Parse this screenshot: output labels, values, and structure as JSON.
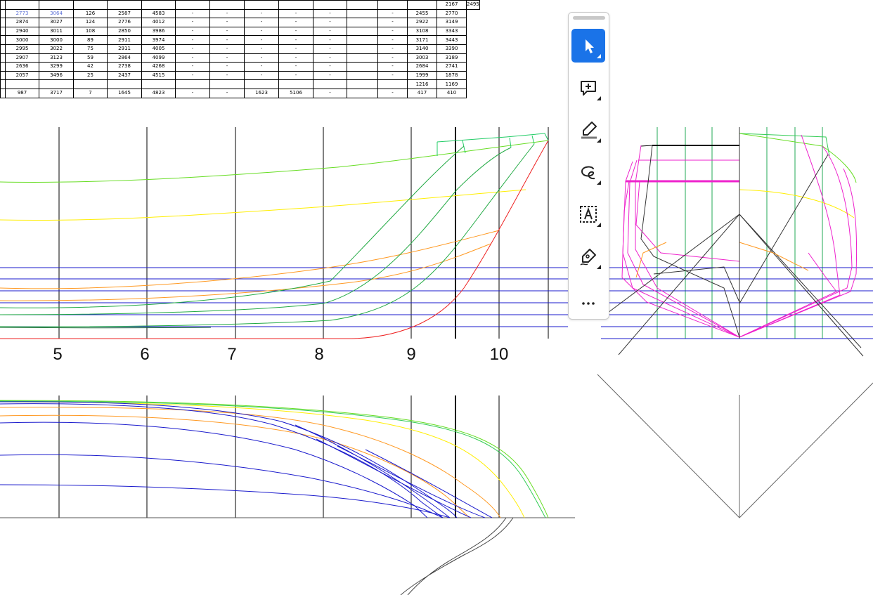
{
  "offset_table": {
    "rows": [
      [
        "",
        "",
        "",
        "",
        "",
        "",
        "",
        "",
        "",
        "",
        "",
        "",
        "",
        "2167",
        "2495"
      ],
      [
        "2773",
        "3064",
        "126",
        "2587",
        "4583",
        "-",
        "-",
        "-",
        "-",
        "-",
        "",
        "-",
        "2455",
        "2770"
      ],
      [
        "2874",
        "3027",
        "124",
        "2776",
        "4012",
        "-",
        "-",
        "-",
        "-",
        "-",
        "",
        "-",
        "2922",
        "3149"
      ],
      [
        "2940",
        "3011",
        "108",
        "2850",
        "3986",
        "-",
        "-",
        "-",
        "-",
        "-",
        "",
        "-",
        "3108",
        "3343"
      ],
      [
        "3000",
        "3000",
        "89",
        "2911",
        "3974",
        "-",
        "-",
        "-",
        "-",
        "-",
        "",
        "-",
        "3171",
        "3443"
      ],
      [
        "2995",
        "3022",
        "75",
        "2911",
        "4005",
        "-",
        "-",
        "-",
        "-",
        "-",
        "",
        "-",
        "3140",
        "3390"
      ],
      [
        "2907",
        "3123",
        "59",
        "2864",
        "4099",
        "-",
        "-",
        "-",
        "-",
        "-",
        "",
        "-",
        "3003",
        "3189"
      ],
      [
        "2636",
        "3299",
        "42",
        "2738",
        "4268",
        "-",
        "-",
        "-",
        "-",
        "-",
        "",
        "-",
        "2684",
        "2741"
      ],
      [
        "2057",
        "3496",
        "25",
        "2437",
        "4515",
        "-",
        "-",
        "-",
        "-",
        "-",
        "",
        "-",
        "1999",
        "1878"
      ],
      [
        "",
        "",
        "",
        "",
        "",
        "",
        "",
        "",
        "",
        "",
        "",
        "",
        "1216",
        "1169"
      ],
      [
        "987",
        "3717",
        "7",
        "1645",
        "4823",
        "-",
        "-",
        "1623",
        "5106",
        "-",
        "",
        "-",
        "417",
        "410"
      ]
    ]
  },
  "station_labels": [
    "5",
    "6",
    "7",
    "8",
    "9",
    "10"
  ],
  "colors": {
    "sheer": "#66dd22",
    "waterline_yellow": "#ffee00",
    "waterline_orange": "#ff9922",
    "buttock_green": "#22aa44",
    "stem_red": "#ee2222",
    "waterline_blue": "#1a1acc",
    "body_magenta": "#ee22cc",
    "station_green": "#22aa55",
    "toolbar_accent": "#1a73e8"
  },
  "toolbar": {
    "tools": [
      {
        "name": "select-tool",
        "icon": "cursor-arrow-icon",
        "active": true
      },
      {
        "name": "add-comment-tool",
        "icon": "comment-plus-icon",
        "active": false
      },
      {
        "name": "highlight-tool",
        "icon": "highlighter-icon",
        "active": false
      },
      {
        "name": "draw-freehand-tool",
        "icon": "lasso-curve-icon",
        "active": false
      },
      {
        "name": "add-text-tool",
        "icon": "text-box-icon",
        "active": false
      },
      {
        "name": "signature-tool",
        "icon": "pen-sign-icon",
        "active": false
      },
      {
        "name": "more-tools",
        "icon": "more-dots-icon",
        "active": false
      }
    ]
  }
}
